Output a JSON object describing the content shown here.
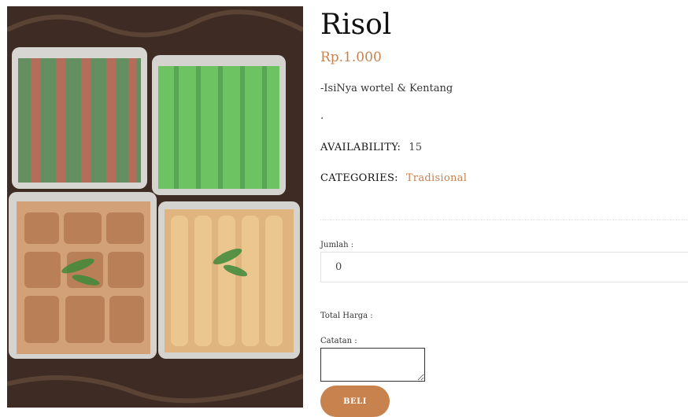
{
  "product": {
    "title": "Risol",
    "price": "Rp.1.000",
    "description": "-IsiNya wortel & Kentang",
    "dot": ".",
    "availability_label": "AVAILABILITY:",
    "availability_value": "15",
    "categories_label": "CATEGORIES:",
    "category": "Tradisional"
  },
  "form": {
    "quantity_label": "Jumlah :",
    "quantity_value": "0",
    "total_label": "Total Harga :",
    "notes_label": "Catatan :",
    "buy_label": "BELI"
  },
  "colors": {
    "accent": "#c7824e"
  }
}
